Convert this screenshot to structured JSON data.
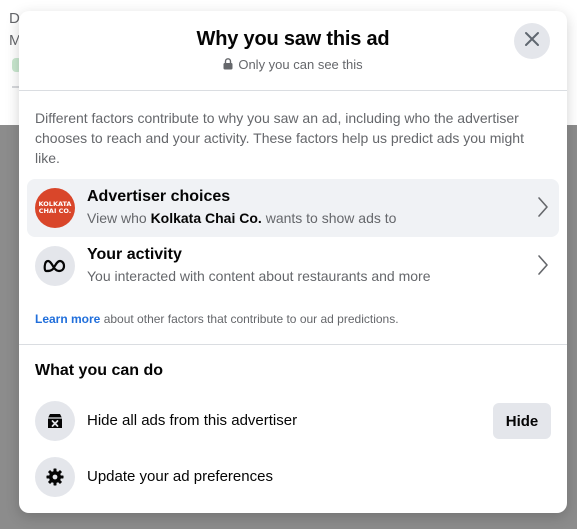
{
  "background": {
    "line1": "D",
    "line2": "M"
  },
  "modal": {
    "title": "Why you saw this ad",
    "privacy_note": "Only you can see this",
    "intro": "Different factors contribute to why you saw an ad, including who the advertiser chooses to reach and your activity. These factors help us predict ads you might like.",
    "advertiser_row": {
      "title": "Advertiser choices",
      "sub_prefix": "View who ",
      "advertiser_name": "Kolkata Chai Co.",
      "sub_suffix": " wants to show ads to",
      "logo_line1": "KOLKATA",
      "logo_line2": "CHAI CO."
    },
    "activity_row": {
      "title": "Your activity",
      "sub": "You interacted with content about restaurants and more"
    },
    "learn_more_link": "Learn more",
    "learn_more_rest": " about other factors that contribute to our ad predictions.",
    "section_title": "What you can do",
    "actions": {
      "hide_label": "Hide all ads from this advertiser",
      "hide_button": "Hide",
      "prefs_label": "Update your ad preferences"
    }
  },
  "icons": {
    "close": "close-icon",
    "lock": "lock-icon",
    "chevron": "chevron-right-icon",
    "meta": "meta-logo-icon",
    "hide_ads": "ad-hide-icon",
    "settings": "gear-icon"
  },
  "colors": {
    "link": "#216fdb",
    "advertiser_logo": "#d9462a",
    "overlay": "#8c8c8c",
    "button_bg": "#e4e6eb"
  }
}
